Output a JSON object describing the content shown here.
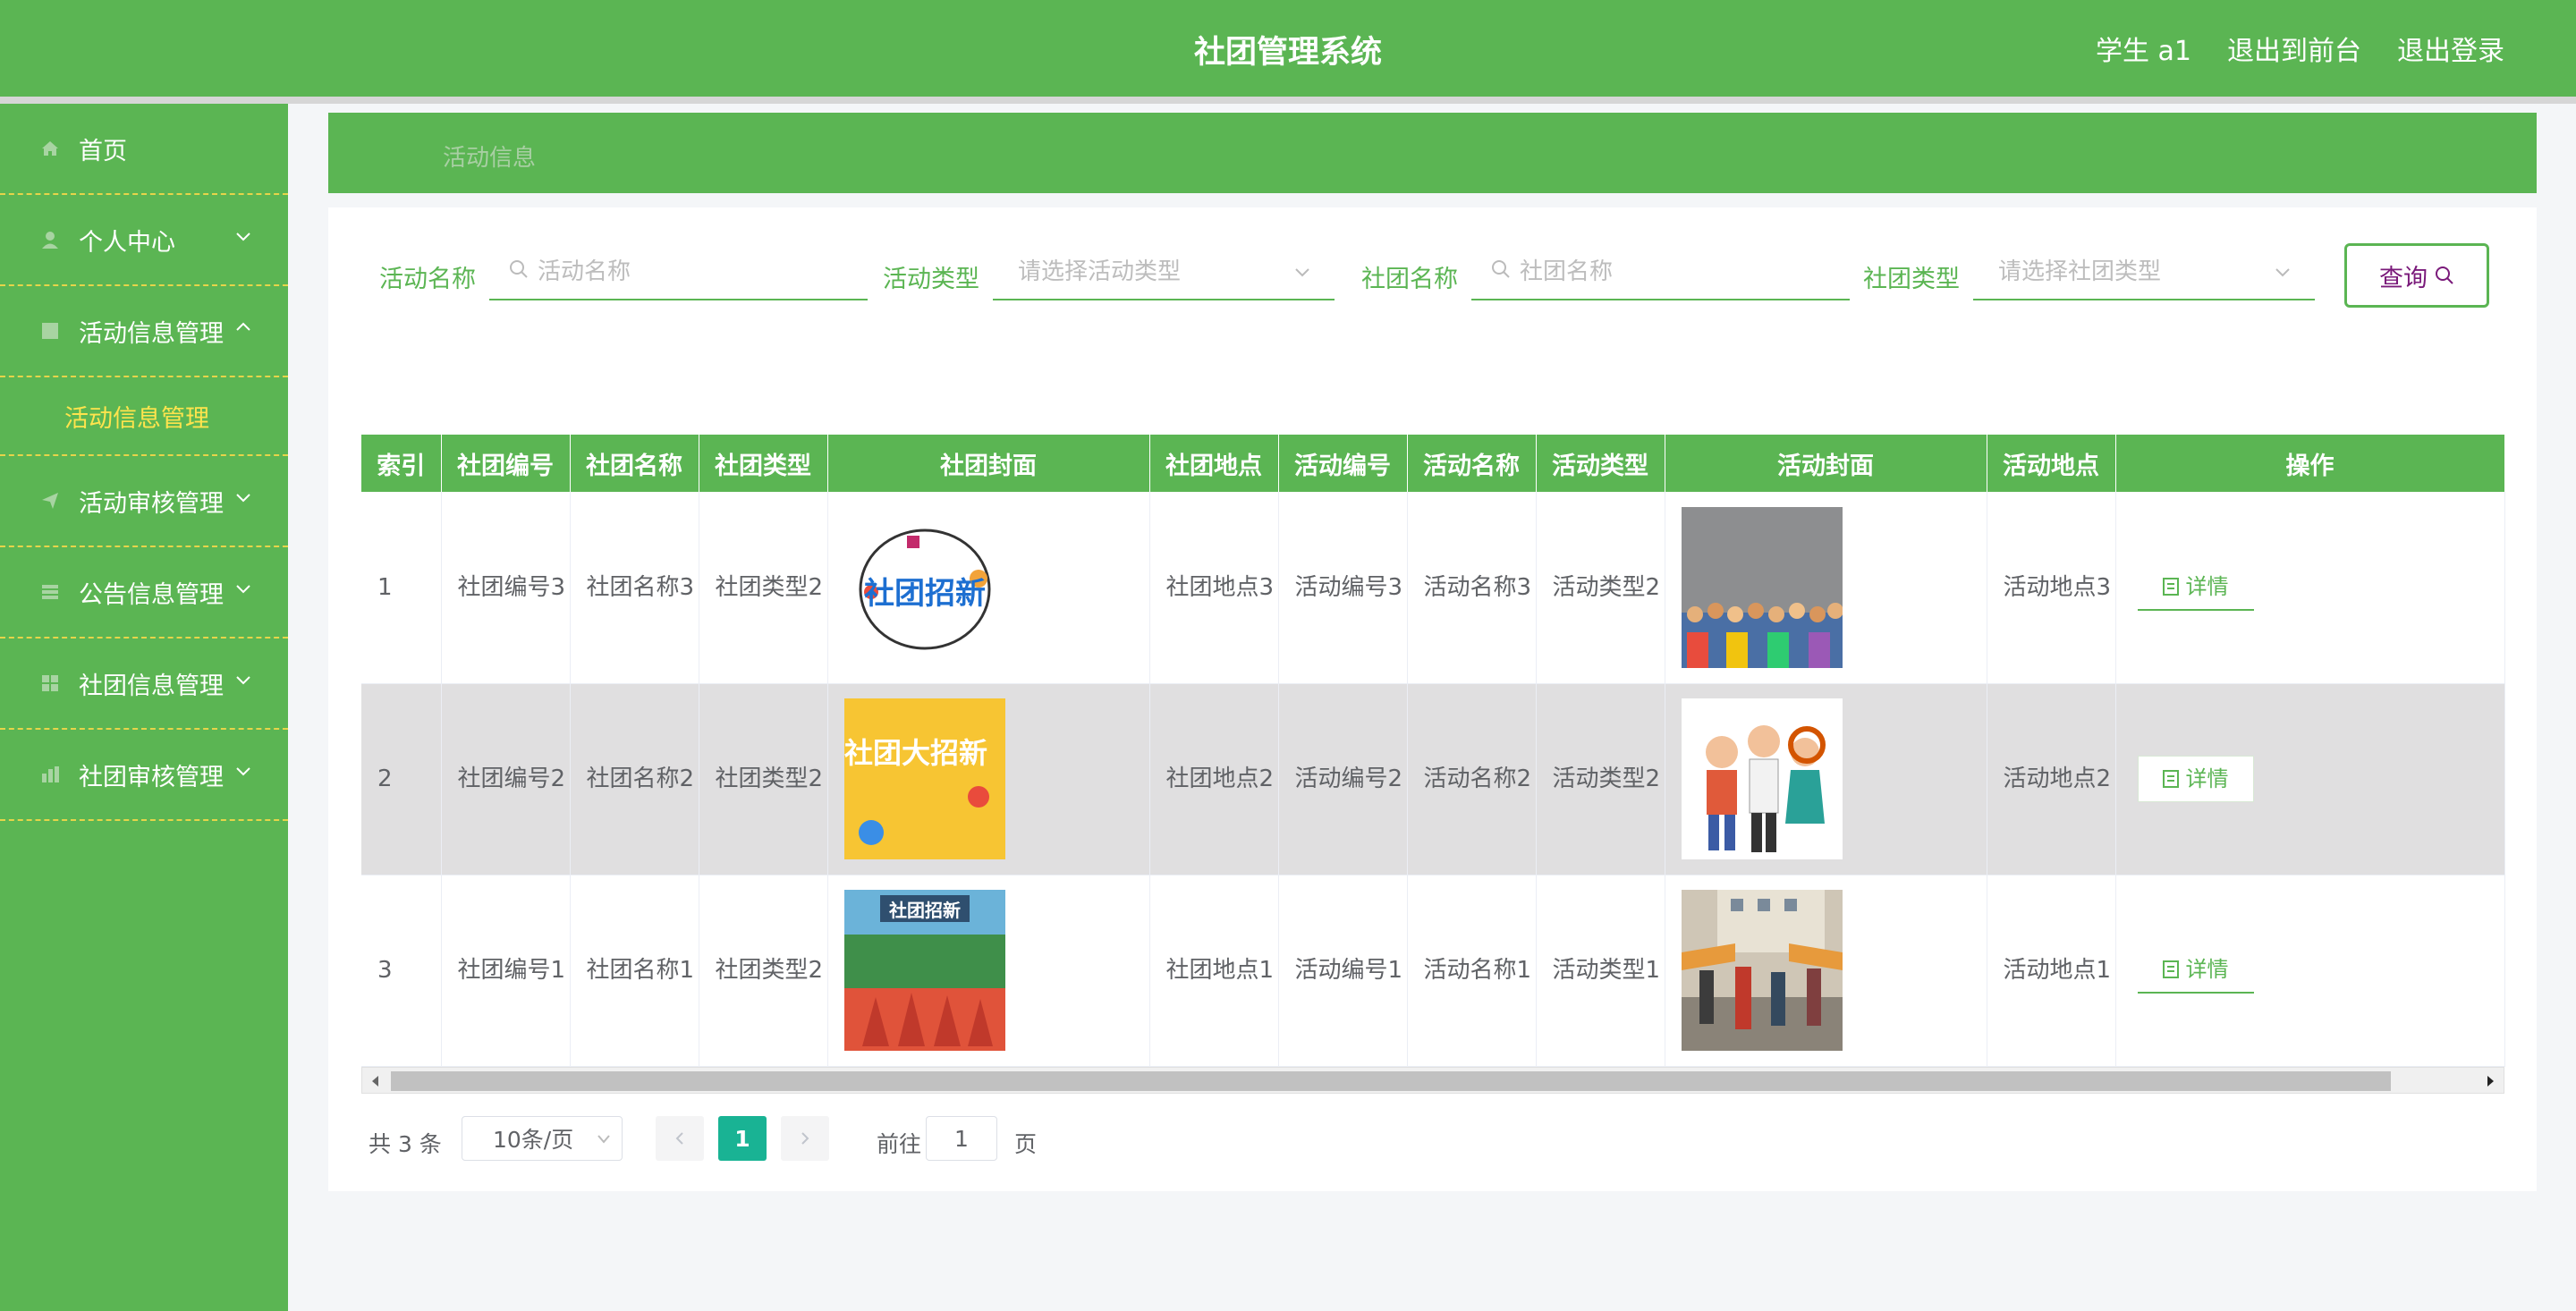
{
  "header": {
    "title": "社团管理系统",
    "user": "学生 a1",
    "front_link": "退出到前台",
    "logout_link": "退出登录"
  },
  "sidebar": {
    "items": [
      {
        "label": "首页",
        "icon": "home-icon"
      },
      {
        "label": "个人中心",
        "icon": "user-icon"
      },
      {
        "label": "活动信息管理",
        "icon": "grid-icon",
        "expanded": true,
        "sub": [
          {
            "label": "活动信息管理"
          }
        ]
      },
      {
        "label": "活动审核管理",
        "icon": "send-icon"
      },
      {
        "label": "公告信息管理",
        "icon": "list-icon"
      },
      {
        "label": "社团信息管理",
        "icon": "grid-icon"
      },
      {
        "label": "社团审核管理",
        "icon": "chart-icon"
      }
    ]
  },
  "breadcrumb": "活动信息",
  "search": {
    "activity_name_label": "活动名称",
    "activity_name_placeholder": "活动名称",
    "activity_type_label": "活动类型",
    "activity_type_placeholder": "请选择活动类型",
    "club_name_label": "社团名称",
    "club_name_placeholder": "社团名称",
    "club_type_label": "社团类型",
    "club_type_placeholder": "请选择社团类型",
    "query_button": "查询"
  },
  "table": {
    "columns": [
      "索引",
      "社团编号",
      "社团名称",
      "社团类型",
      "社团封面",
      "社团地点",
      "活动编号",
      "活动名称",
      "活动类型",
      "活动封面",
      "活动地点",
      "操作"
    ],
    "rows": [
      {
        "index": "1",
        "club_no": "社团编号3",
        "club_name": "社团名称3",
        "club_type": "社团类型2",
        "club_place": "社团地点3",
        "act_no": "活动编号3",
        "act_name": "活动名称3",
        "act_type": "活动类型2",
        "act_place": "活动地点3",
        "action": "详情"
      },
      {
        "index": "2",
        "club_no": "社团编号2",
        "club_name": "社团名称2",
        "club_type": "社团类型2",
        "club_place": "社团地点2",
        "act_no": "活动编号2",
        "act_name": "活动名称2",
        "act_type": "活动类型2",
        "act_place": "活动地点2",
        "action": "详情"
      },
      {
        "index": "3",
        "club_no": "社团编号1",
        "club_name": "社团名称1",
        "club_type": "社团类型2",
        "club_place": "社团地点1",
        "act_no": "活动编号1",
        "act_name": "活动名称1",
        "act_type": "活动类型1",
        "act_place": "活动地点1",
        "action": "详情"
      }
    ],
    "cover_texts": {
      "club1": "社团招新",
      "club2": "社团大招新",
      "club3": "社团招新"
    }
  },
  "pagination": {
    "total": "共 3 条",
    "page_size": "10条/页",
    "current": "1",
    "goto_label": "前往",
    "goto_value": "1",
    "page_unit": "页"
  },
  "colors": {
    "primary": "#5bb553",
    "accent_yellow": "#ffe44d",
    "pager_active": "#19b394"
  }
}
